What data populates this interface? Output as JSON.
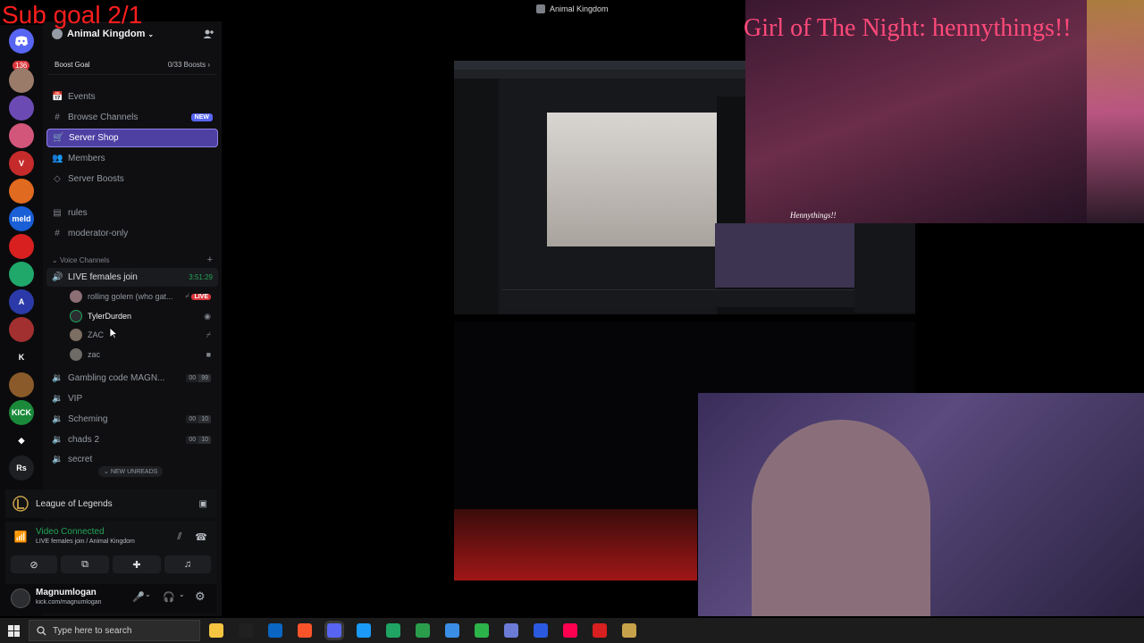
{
  "overlay": {
    "sub_goal": "Sub goal 2/1",
    "window_title": "Animal Kingdom",
    "banner": "Girl of The Night: hennythings!!",
    "cam_tag": "Hennythings!!"
  },
  "rail": {
    "notif_badge": "136",
    "servers": [
      {
        "name": "avatar-server",
        "color": "#9a7b6a",
        "glyph": ""
      },
      {
        "name": "purple-server",
        "color": "#6b4bb3",
        "glyph": ""
      },
      {
        "name": "fox-server",
        "color": "#d2557a",
        "glyph": ""
      },
      {
        "name": "v-server",
        "color": "#c62b2b",
        "glyph": "V"
      },
      {
        "name": "logo-server",
        "color": "#e06a1f",
        "glyph": ""
      },
      {
        "name": "meld-server",
        "color": "#1a5fd6",
        "glyph": "meld"
      },
      {
        "name": "red-app-server",
        "color": "#d82020",
        "glyph": ""
      },
      {
        "name": "green-server",
        "color": "#1fa86a",
        "glyph": ""
      },
      {
        "name": "a-server",
        "color": "#2b3aa8",
        "glyph": "A"
      },
      {
        "name": "avatar2-server",
        "color": "#a33030",
        "glyph": ""
      },
      {
        "name": "kick-green-server",
        "color": "#0b0b0d",
        "glyph": "K"
      },
      {
        "name": "warrior-server",
        "color": "#8a5a2a",
        "glyph": ""
      },
      {
        "name": "kick-keep-server",
        "color": "#1a8a3a",
        "glyph": "KICK"
      },
      {
        "name": "diamond-server",
        "color": "#0b0b0d",
        "glyph": "◆"
      },
      {
        "name": "rs-server",
        "color": "#1e1f22",
        "glyph": "Rs"
      }
    ]
  },
  "server": {
    "name": "Animal Kingdom",
    "boost_goal": "Boost Goal",
    "boost_count": "0/33 Boosts"
  },
  "nav": [
    {
      "label": "Events",
      "icon": "📅"
    },
    {
      "label": "Browse Channels",
      "icon": "#",
      "pill": "NEW"
    },
    {
      "label": "Server Shop",
      "icon": "🛒",
      "active": true
    },
    {
      "label": "Members",
      "icon": "👥"
    },
    {
      "label": "Server Boosts",
      "icon": "◇"
    }
  ],
  "text_channels": [
    {
      "label": "rules"
    },
    {
      "label": "moderator-only"
    }
  ],
  "voice_category": "Voice Channels",
  "voice": {
    "live_channel": "LIVE females join",
    "live_time": "3:51:29",
    "members": [
      {
        "name": "rolling golem (who gat...",
        "live": "LIVE"
      },
      {
        "name": "TylerDurden"
      },
      {
        "name": "ZAC"
      },
      {
        "name": "zac"
      }
    ],
    "channels": [
      {
        "label": "Gambling code MAGN...",
        "a": "00",
        "b": "99"
      },
      {
        "label": "VIP"
      },
      {
        "label": "Scheming",
        "a": "00",
        "b": "10"
      },
      {
        "label": "chads 2",
        "a": "00",
        "b": "10"
      },
      {
        "label": "secret"
      }
    ],
    "new_unreads": "NEW UNREADS"
  },
  "activity": {
    "game": "League of Legends"
  },
  "voice_status": {
    "connected": "Video Connected",
    "location": "LIVE females join / Animal Kingdom"
  },
  "user": {
    "name": "Magnumlogan",
    "status": "kick.com/magnumlogan"
  },
  "taskbar": {
    "search_placeholder": "Type here to search",
    "apps": [
      "#f5c542",
      "#202020",
      "#0a66c2",
      "#fb542b",
      "#5865f2",
      "#1b9af7",
      "#1fa463",
      "#2a9d4b",
      "#3a8ee6",
      "#2cb34a",
      "#6b7bd6",
      "#2b5ae0",
      "#ff0050",
      "#d82020",
      "#c8a24a"
    ]
  }
}
